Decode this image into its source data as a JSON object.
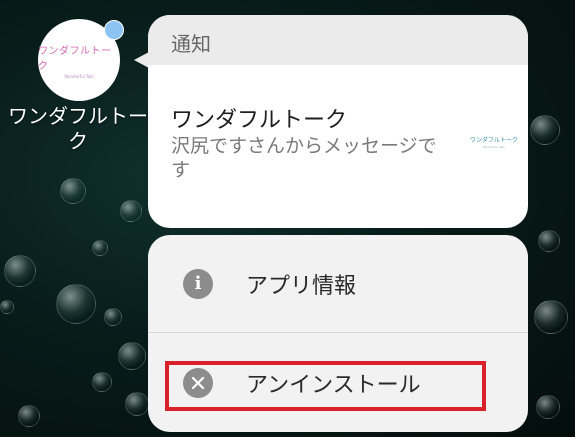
{
  "app": {
    "name": "ワンダフルトーク",
    "icon_logo": "ワンダフルトーク",
    "icon_logo_sub": "Wonderful Talk",
    "badge_color": "#8cc3f2"
  },
  "notification": {
    "header": "通知",
    "title": "ワンダフルトーク",
    "message": "沢尻ですさんからメッセージです",
    "thumbnail_logo": "ワンダフルトーク",
    "thumbnail_logo_sub": "Wonderful Talk"
  },
  "menu": {
    "items": [
      {
        "label": "アプリ情報",
        "icon": "info-icon"
      },
      {
        "label": "アンインストール",
        "icon": "close-circle-icon"
      }
    ]
  },
  "annotation": {
    "highlight_color": "#d9212c",
    "highlighted_item": "アンインストール"
  }
}
